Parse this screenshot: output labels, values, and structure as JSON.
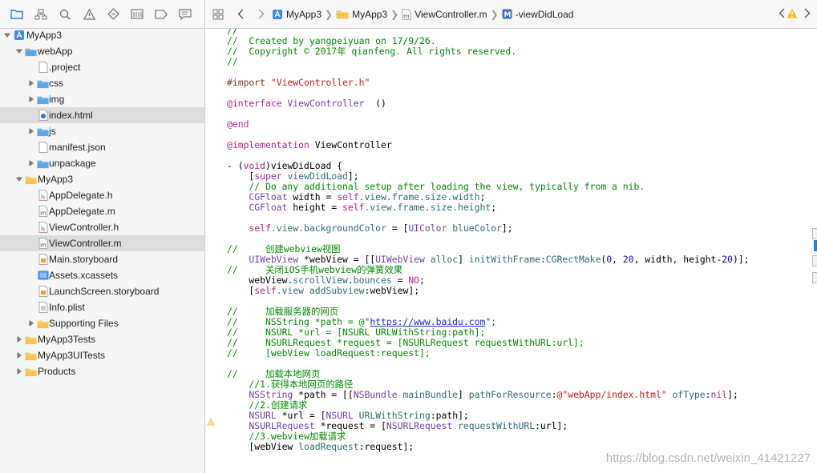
{
  "colors": {
    "folder": "#5aa9e6",
    "group": "#f5c54f",
    "selected_row": "#dcdcdc",
    "comment": "#008a00",
    "keyword": "#b0208c",
    "string": "#c41a16"
  },
  "navigator": {
    "toolbar_icons": [
      "folder-icon",
      "hierarchy-icon",
      "search-icon",
      "warning-icon",
      "breakpoint-icon",
      "report-icon",
      "tag-icon",
      "comment-icon"
    ],
    "items": [
      {
        "label": "MyApp3",
        "icon": "project-icon",
        "disclosure": "open"
      },
      {
        "label": "webApp",
        "icon": "blue-folder-icon",
        "disclosure": "open"
      },
      {
        "label": ".project",
        "icon": "file-icon",
        "disclosure": ""
      },
      {
        "label": "css",
        "icon": "blue-folder-icon",
        "disclosure": "closed"
      },
      {
        "label": "img",
        "icon": "blue-folder-icon",
        "disclosure": "closed"
      },
      {
        "label": "index.html",
        "icon": "html-file-icon",
        "disclosure": "",
        "selected": true
      },
      {
        "label": "js",
        "icon": "blue-folder-icon",
        "disclosure": "closed"
      },
      {
        "label": "manifest.json",
        "icon": "file-icon",
        "disclosure": ""
      },
      {
        "label": "unpackage",
        "icon": "blue-folder-icon",
        "disclosure": "closed"
      },
      {
        "label": "MyApp3",
        "icon": "yellow-folder-icon",
        "disclosure": "open"
      },
      {
        "label": "AppDelegate.h",
        "icon": "header-file-icon",
        "disclosure": ""
      },
      {
        "label": "AppDelegate.m",
        "icon": "source-file-icon",
        "disclosure": ""
      },
      {
        "label": "ViewController.h",
        "icon": "header-file-icon",
        "disclosure": ""
      },
      {
        "label": "ViewController.m",
        "icon": "source-file-icon",
        "disclosure": "",
        "selected": true
      },
      {
        "label": "Main.storyboard",
        "icon": "storyboard-icon",
        "disclosure": ""
      },
      {
        "label": "Assets.xcassets",
        "icon": "assets-icon",
        "disclosure": ""
      },
      {
        "label": "LaunchScreen.storyboard",
        "icon": "storyboard-icon",
        "disclosure": ""
      },
      {
        "label": "Info.plist",
        "icon": "plist-icon",
        "disclosure": ""
      },
      {
        "label": "Supporting Files",
        "icon": "yellow-folder-icon",
        "disclosure": "closed"
      },
      {
        "label": "MyApp3Tests",
        "icon": "yellow-folder-icon",
        "disclosure": "closed"
      },
      {
        "label": "MyApp3UITests",
        "icon": "yellow-folder-icon",
        "disclosure": "closed"
      },
      {
        "label": "Products",
        "icon": "yellow-folder-icon",
        "disclosure": "closed"
      }
    ]
  },
  "jumpbar": {
    "segments": [
      {
        "label": "MyApp3",
        "icon": "project-icon"
      },
      {
        "label": "MyApp3",
        "icon": "yellow-folder-icon"
      },
      {
        "label": "ViewController.m",
        "icon": "source-file-icon"
      },
      {
        "label": "-viewDidLoad",
        "icon": "method-icon"
      }
    ],
    "method_badge": "M"
  },
  "editor": {
    "code_lines": [
      [
        [
          "cmt",
          "//"
        ]
      ],
      [
        [
          "cmt",
          "//  Created by yangpeiyuan on 17/9/26."
        ]
      ],
      [
        [
          "cmt",
          "//  Copyright © 2017年 qianfeng. All rights reserved."
        ]
      ],
      [
        [
          "cmt",
          "//"
        ]
      ],
      [],
      [
        [
          "pp",
          "#import "
        ],
        [
          "str",
          "\"ViewController.h\""
        ]
      ],
      [],
      [
        [
          "kw",
          "@interface"
        ],
        [
          "cls",
          " ViewController"
        ],
        [
          "",
          "  ()"
        ]
      ],
      [],
      [
        [
          "kw",
          "@end"
        ]
      ],
      [],
      [
        [
          "kw",
          "@implementation"
        ],
        [
          "",
          " ViewController"
        ]
      ],
      [],
      [
        [
          "",
          "- ("
        ],
        [
          "kw",
          "void"
        ],
        [
          "",
          ")viewDidLoad {"
        ]
      ],
      [
        [
          "",
          "    ["
        ],
        [
          "kw",
          "super"
        ],
        [
          "mth",
          " viewDidLoad"
        ],
        [
          "",
          "];"
        ]
      ],
      [
        [
          "cmt",
          "    // Do any additional setup after loading the view, typically from a nib."
        ]
      ],
      [
        [
          "cls",
          "    CGFloat"
        ],
        [
          "",
          " width = "
        ],
        [
          "kw",
          "self"
        ],
        [
          "mth",
          ".view.frame.size.width"
        ],
        [
          "",
          ";"
        ]
      ],
      [
        [
          "cls",
          "    CGFloat"
        ],
        [
          "",
          " height = "
        ],
        [
          "kw",
          "self"
        ],
        [
          "mth",
          ".view.frame.size.height"
        ],
        [
          "",
          ";"
        ]
      ],
      [],
      [
        [
          "kw",
          "    self"
        ],
        [
          "mth",
          ".view.backgroundColor"
        ],
        [
          "",
          " = ["
        ],
        [
          "cls",
          "UIColor"
        ],
        [
          "mth",
          " blueColor"
        ],
        [
          "",
          "];"
        ]
      ],
      [],
      [
        [
          "cmt",
          "//     创建webview视图"
        ]
      ],
      [
        [
          "cls",
          "    UIWebView"
        ],
        [
          "",
          " *webView = [["
        ],
        [
          "cls",
          "UIWebView"
        ],
        [
          "mth",
          " alloc"
        ],
        [
          "",
          "] "
        ],
        [
          "mth",
          "initWithFrame"
        ],
        [
          "",
          ":"
        ],
        [
          "mth",
          "CGRectMake"
        ],
        [
          "",
          "("
        ],
        [
          "num",
          "0"
        ],
        [
          "",
          ", "
        ],
        [
          "num",
          "20"
        ],
        [
          "",
          ", width, height-"
        ],
        [
          "num",
          "20"
        ],
        [
          "",
          ")];"
        ]
      ],
      [
        [
          "cmt",
          "//     关闭iOS手机webview的弹簧效果"
        ]
      ],
      [
        [
          "",
          "    webView."
        ],
        [
          "mth",
          "scrollView"
        ],
        [
          "",
          "."
        ],
        [
          "mth",
          "bounces"
        ],
        [
          "",
          " = "
        ],
        [
          "kw",
          "NO"
        ],
        [
          "",
          ";"
        ]
      ],
      [
        [
          "",
          "    ["
        ],
        [
          "kw",
          "self"
        ],
        [
          "mth",
          ".view"
        ],
        [
          "mth",
          " addSubview"
        ],
        [
          "",
          ":webView];"
        ]
      ],
      [],
      [
        [
          "cmt",
          "//     加载服务器的网页"
        ]
      ],
      [
        [
          "cmt",
          "//     NSString *path = @\""
        ],
        [
          "url",
          "https://www.baidu.com"
        ],
        [
          "cmt",
          "\";"
        ]
      ],
      [
        [
          "cmt",
          "//     NSURL *url = [NSURL URLWithString:path];"
        ]
      ],
      [
        [
          "cmt",
          "//     NSURLRequest *request = [NSURLRequest requestWithURL:url];"
        ]
      ],
      [
        [
          "cmt",
          "//     [webView loadRequest:request];"
        ]
      ],
      [],
      [
        [
          "cmt",
          "//     加载本地网页"
        ]
      ],
      [
        [
          "cmt",
          "    //1.获得本地网页的路径"
        ]
      ],
      [
        [
          "cls",
          "    NSString"
        ],
        [
          "",
          " *path = [["
        ],
        [
          "cls",
          "NSBundle"
        ],
        [
          "mth",
          " mainBundle"
        ],
        [
          "",
          "] "
        ],
        [
          "mth",
          "pathForResource"
        ],
        [
          "",
          ":"
        ],
        [
          "str",
          "@\"webApp/index.html\""
        ],
        [
          "",
          " "
        ],
        [
          "mth",
          "ofType"
        ],
        [
          "",
          ":"
        ],
        [
          "kw",
          "nil"
        ],
        [
          "",
          "];"
        ]
      ],
      [
        [
          "cmt",
          "    //2.创建请求"
        ]
      ],
      [
        [
          "cls",
          "    NSURL"
        ],
        [
          "",
          " *url = ["
        ],
        [
          "cls",
          "NSURL"
        ],
        [
          "mth",
          " URLWithString"
        ],
        [
          "",
          ":path];"
        ]
      ],
      [
        [
          "cls",
          "    NSURLRequest"
        ],
        [
          "",
          " *request = ["
        ],
        [
          "cls",
          "NSURLRequest"
        ],
        [
          "mth",
          " requestWithURL"
        ],
        [
          "",
          ":url];"
        ]
      ],
      [
        [
          "cmt",
          "    //3.webview加载请求"
        ]
      ],
      [
        [
          "",
          "    [webView "
        ],
        [
          "mth",
          "loadRequest"
        ],
        [
          "",
          ":request];"
        ]
      ]
    ]
  },
  "watermark": "https://blog.csdn.net/weixin_41421227"
}
